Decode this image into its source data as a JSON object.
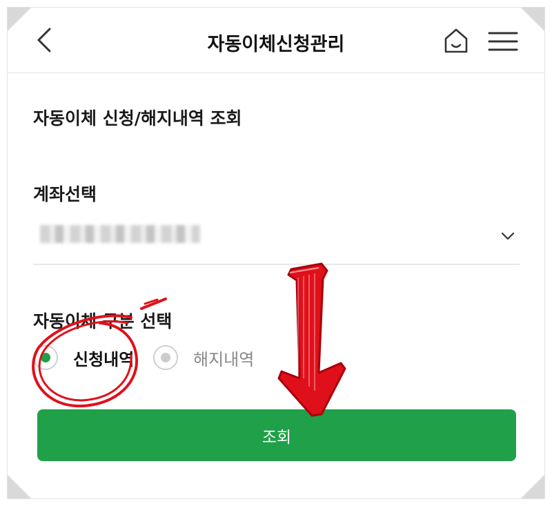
{
  "header": {
    "title": "자동이체신청관리",
    "back_icon": "chevron-left-icon",
    "home_icon": "home-icon",
    "menu_icon": "hamburger-menu-icon"
  },
  "section": {
    "title": "자동이체 신청/해지내역 조회"
  },
  "account": {
    "label": "계좌선택",
    "value_masked": true,
    "dropdown_icon": "chevron-down-icon"
  },
  "transfer_type": {
    "label": "자동이체 구분 선택",
    "options": [
      {
        "label": "신청내역",
        "selected": true
      },
      {
        "label": "해지내역",
        "selected": false
      }
    ]
  },
  "submit": {
    "label": "조회"
  },
  "colors": {
    "accent_green": "#1fa049",
    "radio_selected": "#1fa049",
    "radio_unselected": "#cccccc",
    "annotation_red": "#e0101a"
  },
  "annotations": {
    "circle": "red hand-drawn circle around 신청내역",
    "arrow": "red hand-drawn arrow pointing down to 조회 button"
  }
}
